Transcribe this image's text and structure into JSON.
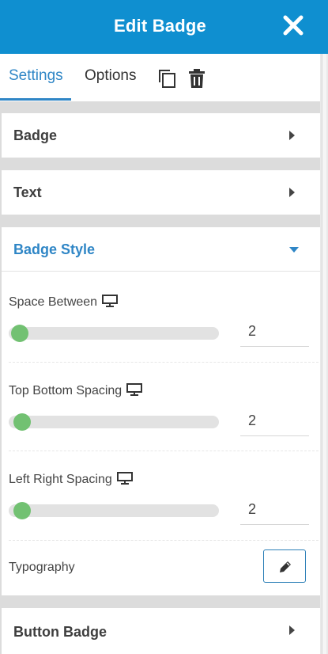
{
  "header": {
    "title": "Edit Badge",
    "close_icon": "close-icon"
  },
  "tabs": [
    {
      "label": "Settings",
      "active": true
    },
    {
      "label": "Options",
      "active": false
    }
  ],
  "tab_actions": [
    "duplicate-icon",
    "trash-icon"
  ],
  "sections": {
    "badge": {
      "label": "Badge"
    },
    "text": {
      "label": "Text"
    },
    "badge_style": {
      "label": "Badge Style",
      "expanded": true,
      "fields": [
        {
          "label": "Space Between",
          "value": "2"
        },
        {
          "label": "Top Bottom Spacing",
          "value": "2"
        },
        {
          "label": "Left Right Spacing",
          "value": "2"
        }
      ],
      "typography": {
        "label": "Typography",
        "icon": "pencil-icon"
      }
    },
    "button_badge": {
      "label": "Button Badge"
    }
  },
  "colors": {
    "header": "#0f8fd0",
    "accent": "#2f86c6",
    "slider_knob": "#72c172"
  }
}
